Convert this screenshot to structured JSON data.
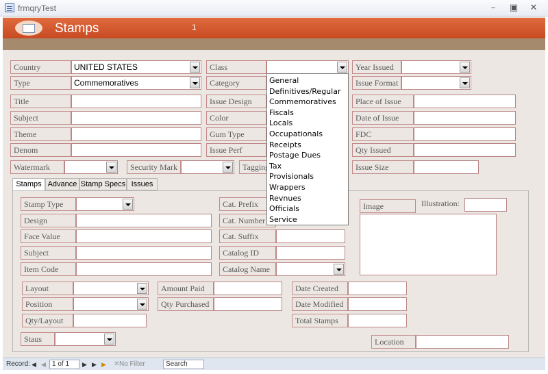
{
  "window": {
    "title": "frmqryTest"
  },
  "header": {
    "title": "Stamps",
    "record_count": "1"
  },
  "row1": {
    "country_label": "Country",
    "country_value": "UNITED STATES",
    "class_label": "Class",
    "class_value": "",
    "year_issued_label": "Year Issued",
    "year_issued_value": ""
  },
  "row2": {
    "type_label": "Type",
    "type_value": "Commemoratives",
    "category_label": "Category",
    "issue_format_label": "Issue Format",
    "issue_format_value": ""
  },
  "fields_left": [
    "Title",
    "Subject",
    "Theme",
    "Denom"
  ],
  "fields_mid": [
    "Issue Design",
    "Color",
    "Gum Type",
    "Issue Perf"
  ],
  "fields_right": [
    "Place of Issue",
    "Date of Issue",
    "FDC",
    "Qty Issued"
  ],
  "row_wm": {
    "watermark_label": "Watermark",
    "security_mark_label": "Security Mark",
    "tagging_label": "Tagging",
    "issue_size_label": "Issue Size"
  },
  "class_dropdown": {
    "options": [
      "General",
      "Definitives/Regular",
      "Commemoratives",
      "Fiscals",
      "Locals",
      "Occupationals",
      "Receipts",
      "Postage Dues",
      "Tax",
      "Provisionals",
      "Wrappers",
      "Revnues",
      "Officials",
      "Service"
    ]
  },
  "tabs": [
    "Stamps",
    "Advance",
    "Stamp Specs",
    "Issues"
  ],
  "stamps_tab": {
    "left_labels": [
      "Stamp Type",
      "Design",
      "Face Value",
      "Subject",
      "Item Code"
    ],
    "mid_labels": [
      "Cat. Prefix",
      "Cat. Number",
      "Cat. Suffix",
      "Catalog ID",
      "Catalog Name"
    ],
    "image_label": "Image",
    "illustration_label": "Illustration:",
    "layout_label": "Layout",
    "position_label": "Position",
    "qty_layout_label": "Qty/Layout",
    "amount_paid_label": "Amount Paid",
    "qty_purchased_label": "Qty Purchased",
    "date_created_label": "Date Created",
    "date_modified_label": "Date Modified",
    "total_stamps_label": "Total Stamps",
    "status_label": "Staus",
    "location_label": "Location"
  },
  "navigation": {
    "record_label": "Record:",
    "current": "1 of 1",
    "filter_label": "No Filter",
    "search_label": "Search"
  }
}
